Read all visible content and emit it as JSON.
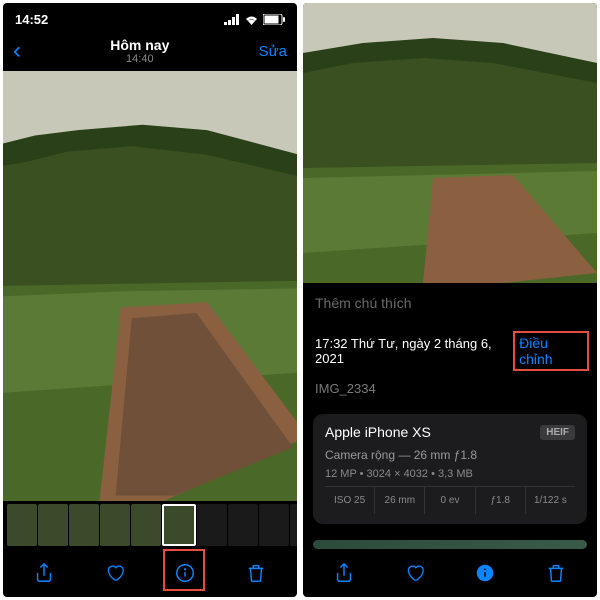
{
  "left": {
    "status_time": "14:52",
    "nav_title": "Hôm nay",
    "nav_sub": "14:40",
    "edit": "Sửa"
  },
  "right": {
    "caption": "Thêm chú thích",
    "meta_time": "17:32 Thứ Tư, ngày 2 tháng 6, 2021",
    "adjust": "Điều chỉnh",
    "filename": "IMG_2334",
    "device": "Apple iPhone XS",
    "badge": "HEIF",
    "camera": "Camera rộng — 26 mm ƒ1.8",
    "specs": "12 MP  •  3024 × 4032  •  3,3 MB",
    "iso": "ISO 25",
    "focal": "26 mm",
    "ev": "0 ev",
    "aperture": "ƒ1.8",
    "shutter": "1/122 s"
  }
}
